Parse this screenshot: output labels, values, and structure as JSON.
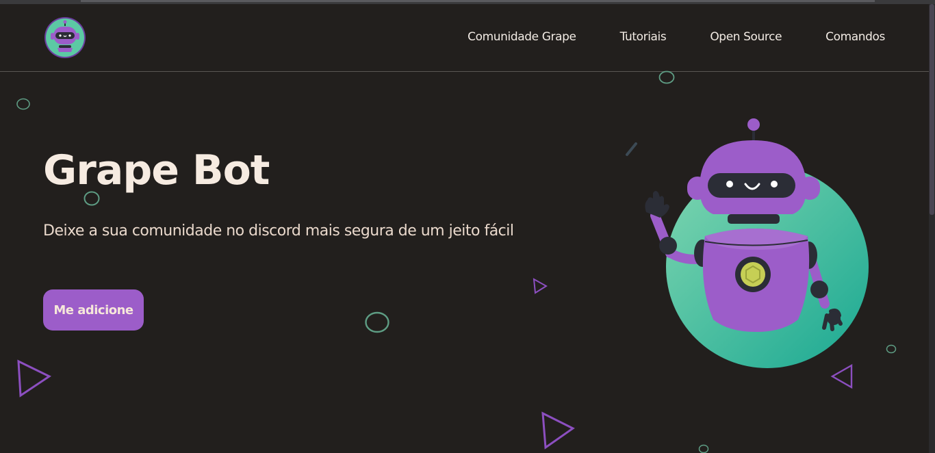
{
  "nav": {
    "logo_icon": "robot-avatar-icon",
    "links": [
      {
        "label": "Comunidade Grape"
      },
      {
        "label": "Tutoriais"
      },
      {
        "label": "Open Source"
      },
      {
        "label": "Comandos"
      }
    ]
  },
  "hero": {
    "title": "Grape Bot",
    "subtitle": "Deixe a sua comunidade no discord mais segura de um jeito fácil",
    "cta_label": "Me adicione",
    "illustration_icon": "waving-robot-illustration"
  },
  "colors": {
    "background": "#221f1d",
    "accent_purple": "#9c5dc9",
    "accent_green": "#4fc3a1",
    "text": "#f6ebe1"
  }
}
